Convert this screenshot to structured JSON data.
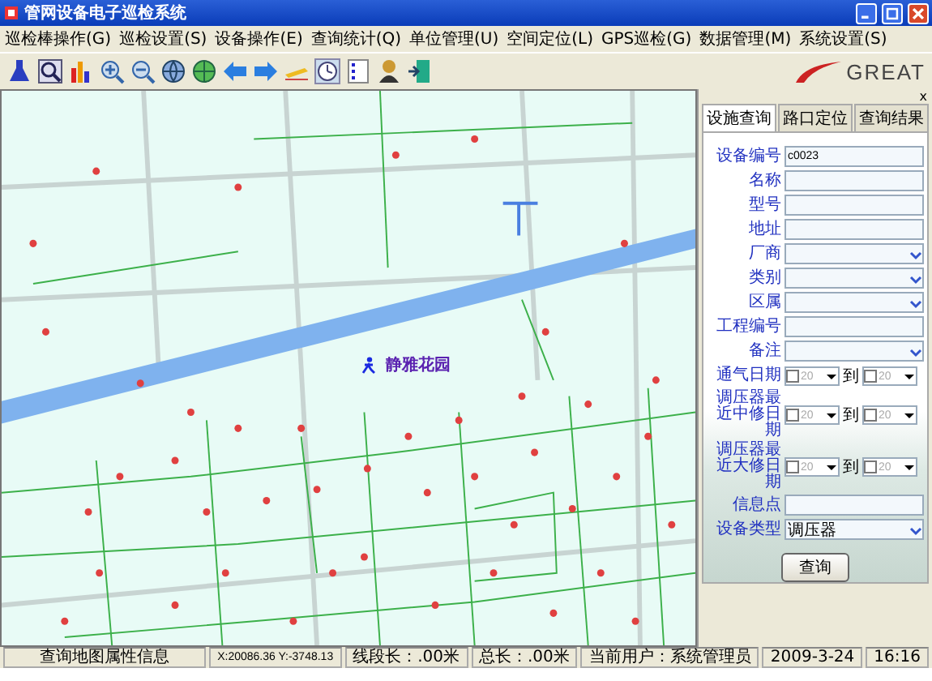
{
  "window": {
    "title": "管网设备电子巡检系统"
  },
  "menu": [
    "巡检棒操作(G)",
    "巡检设置(S)",
    "设备操作(E)",
    "查询统计(Q)",
    "单位管理(U)",
    "空间定位(L)",
    "GPS巡检(G)",
    "数据管理(M)",
    "系统设置(S)"
  ],
  "logo": {
    "text": "GREAT"
  },
  "map": {
    "place_label": "静雅花园"
  },
  "panel": {
    "close": "x",
    "tabs": [
      {
        "label": "设施查询",
        "selected": true
      },
      {
        "label": "路口定位",
        "selected": false
      },
      {
        "label": "查询结果",
        "selected": false
      }
    ],
    "fields": [
      {
        "label": "设备编号",
        "kind": "text",
        "value": "c0023"
      },
      {
        "label": "名称",
        "kind": "text"
      },
      {
        "label": "型号",
        "kind": "text"
      },
      {
        "label": "地址",
        "kind": "text"
      },
      {
        "label": "厂商",
        "kind": "select"
      },
      {
        "label": "类别",
        "kind": "select"
      },
      {
        "label": "区属",
        "kind": "select"
      },
      {
        "label": "工程编号",
        "kind": "text"
      },
      {
        "label": "备注",
        "kind": "select"
      },
      {
        "label": "通气日期",
        "kind": "daterange",
        "from": "20",
        "separator": "到",
        "to": "20"
      },
      {
        "label": "调压器最近中修日期",
        "kind": "daterange",
        "from": "20",
        "separator": "到",
        "to": "20"
      },
      {
        "label": "调压器最近大修日期",
        "kind": "daterange",
        "from": "20",
        "separator": "到",
        "to": "20"
      },
      {
        "label": "信息点",
        "kind": "text"
      },
      {
        "label": "设备类型",
        "kind": "select",
        "value": "调压器"
      }
    ],
    "button": "查询"
  },
  "status_bar": [
    "查询地图属性信息",
    "X:20086.36 Y:-3748.13",
    "线段长：.00米",
    "总长：.00米",
    "当前用户：系统管理员",
    "2009-3-24",
    "16:16"
  ]
}
